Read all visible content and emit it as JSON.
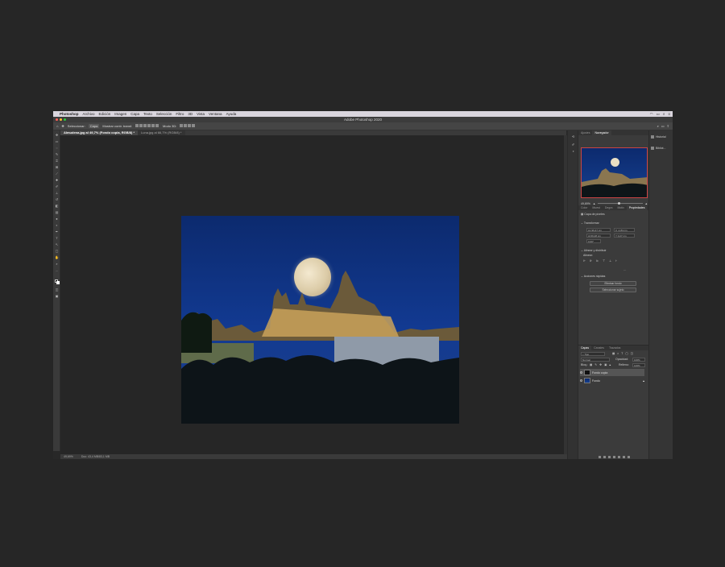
{
  "menubar": {
    "apple": "",
    "app": "Photoshop",
    "items": [
      "Archivo",
      "Edición",
      "Imagen",
      "Capa",
      "Texto",
      "Selección",
      "Filtro",
      "3D",
      "Vista",
      "Ventana",
      "Ayuda"
    ]
  },
  "window": {
    "title": "Adobe Photoshop 2020"
  },
  "options": {
    "select_label": "Seleccionar:",
    "select_value": "Capa",
    "transform_label": "Mostrar contr. transf.",
    "mode_3d": "Modo 3D:"
  },
  "tabs": [
    {
      "label": "Almudena.jpg al 49,7% (Fondo copia, RGB/8) *",
      "active": true
    },
    {
      "label": "Luna.jpg al 66,7% (RGB/8) *",
      "active": false
    }
  ],
  "status": {
    "zoom": "49,69%",
    "doc": "Doc: 43,4 MB/83,1 MB"
  },
  "panels": {
    "top_tabs": [
      "Ajustes",
      "Navegador"
    ],
    "zoom_value": "49,69%",
    "prop_tabs": [
      "Color",
      "Muest",
      "Degra",
      "Motiv",
      "Propiedades",
      "Bibliot"
    ],
    "pixel_layer": "Capa de píxeles",
    "transform_title": "Transformar",
    "w_label": "An",
    "w_value": "96,47 cm",
    "h_label": "Al",
    "h_value": "69,28 cm",
    "x_label": "X",
    "x_value": "-1,84 cm",
    "y_label": "Y",
    "y_value": "0,27 cm",
    "angle_value": "0,00°",
    "align_title": "Alinear y distribuir",
    "align_sub": "Alinear:",
    "quick_title": "Acciones rápidas",
    "quick_btn1": "Eliminar fondo",
    "quick_btn2": "Seleccionar sujeto"
  },
  "layers": {
    "tabs": [
      "Capas",
      "Canales",
      "Trazados"
    ],
    "kind": "Tipo",
    "blend": "Normal",
    "opacity_label": "Opacidad:",
    "opacity": "100%",
    "lock_label": "Bloq.:",
    "fill_label": "Relleno:",
    "fill": "100%",
    "items": [
      {
        "name": "Fondo copia",
        "selected": true
      },
      {
        "name": "Fondo",
        "selected": false
      }
    ]
  },
  "right_strip": {
    "items": [
      "Historial",
      "Bibliot..."
    ]
  }
}
